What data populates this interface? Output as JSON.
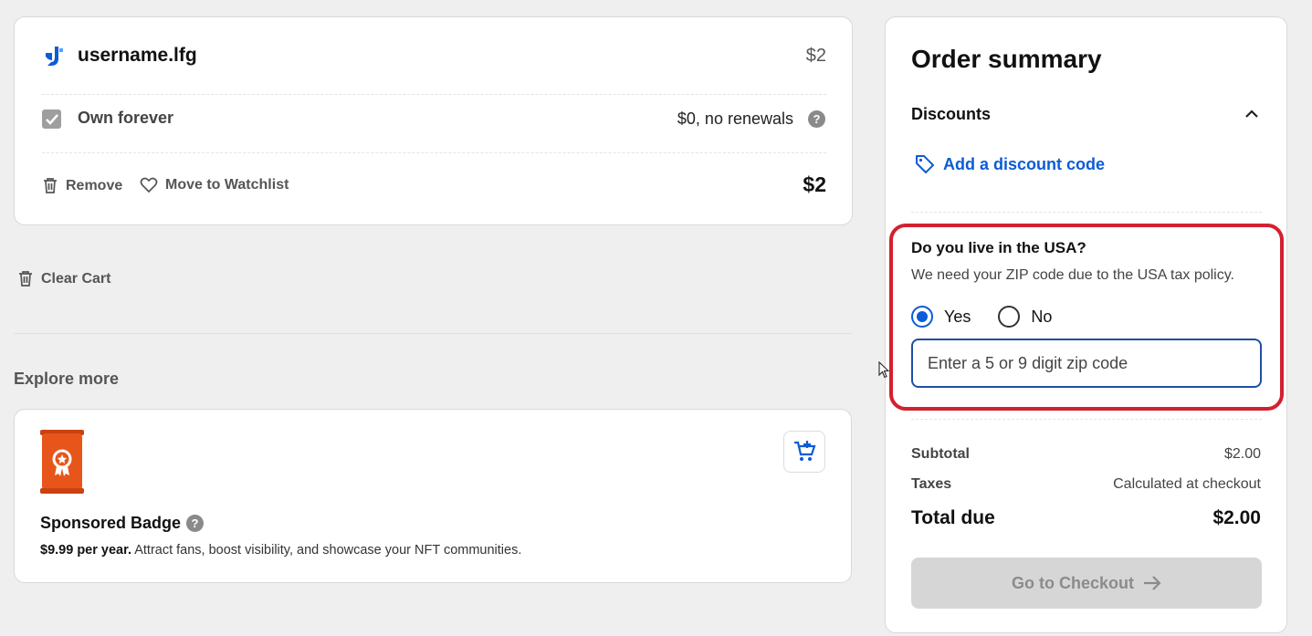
{
  "cart": {
    "domain_name": "username.lfg",
    "domain_price": "$2",
    "own_label": "Own forever",
    "own_value": "$0, no renewals",
    "help_glyph": "?",
    "remove_label": "Remove",
    "watchlist_label": "Move to Watchlist",
    "line_total": "$2",
    "logo_icon": "domain-brand-logo-icon",
    "checkbox_state": "checked-disabled"
  },
  "clear_cart_label": "Clear Cart",
  "explore": {
    "title": "Explore more",
    "badge_title": "Sponsored Badge",
    "badge_price": "$9.99 per year.",
    "badge_desc": " Attract fans, boost visibility, and showcase your NFT communities.",
    "badge_icon": "sponsored-badge-icon",
    "add_to_cart_icon": "cart-plus-icon"
  },
  "summary": {
    "title": "Order summary",
    "discounts_label": "Discounts",
    "discounts_expanded": true,
    "add_discount_label": "Add a discount code",
    "usa_question": "Do you live in the USA?",
    "usa_note": "We need your ZIP code due to the USA tax policy.",
    "yes_label": "Yes",
    "no_label": "No",
    "selected_option": "Yes",
    "zip_placeholder": "Enter a 5 or 9 digit zip code",
    "subtotal_label": "Subtotal",
    "subtotal_value": "$2.00",
    "taxes_label": "Taxes",
    "taxes_value": "Calculated at checkout",
    "total_label": "Total due",
    "total_value": "$2.00",
    "checkout_label": "Go to Checkout"
  },
  "colors": {
    "accent_blue": "#0b5cd6",
    "highlight_red": "#d3202f",
    "badge_orange": "#e8551a",
    "disabled_gray": "#d6d6d6"
  }
}
